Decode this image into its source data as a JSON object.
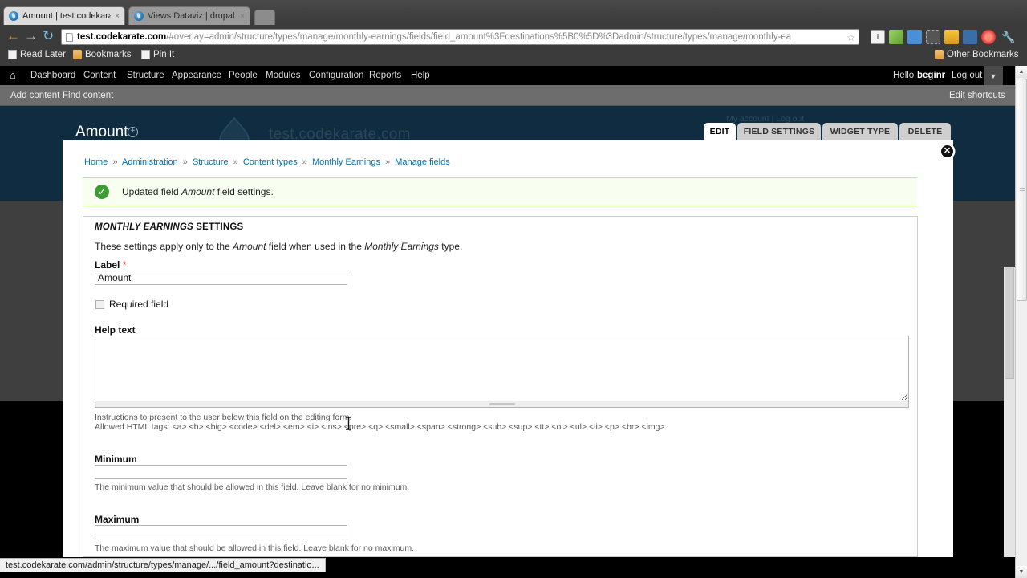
{
  "browser": {
    "tabs": [
      {
        "title": "Amount | test.codekarate",
        "active": true,
        "favicon": "drupal-favicon",
        "close": "×"
      },
      {
        "title": "Views Dataviz | drupal.org",
        "active": false,
        "favicon": "drupal-favicon",
        "close": "×"
      }
    ],
    "nav": {
      "back": "←",
      "forward": "→",
      "reload": "↻"
    },
    "url": {
      "host": "test.codekarate.com",
      "path": "/#overlay=admin/structure/types/manage/monthly-earnings/fields/field_amount%3Fdestinations%5B0%5D%3Dadmin/structure/types/manage/monthly-ea",
      "star_icon": "☆"
    },
    "toolbar_icons": [
      "info-icon",
      "eyedropper-icon",
      "screenshot-icon",
      "evernote-icon",
      "wallet-icon",
      "bookmark-manager-icon",
      "adblock-icon",
      "wrench-icon"
    ],
    "bookmarks": [
      {
        "label": "Read Later",
        "icon": "page-icon"
      },
      {
        "label": "Bookmarks",
        "icon": "folder-icon"
      },
      {
        "label": "Pin It",
        "icon": "page-icon"
      }
    ],
    "other_bookmarks": {
      "label": "Other Bookmarks",
      "icon": "folder-icon"
    },
    "status_bar": "test.codekarate.com/admin/structure/types/manage/.../field_amount?destinatio..."
  },
  "drupal_toolbar": {
    "home_icon": "⌂",
    "items": [
      "Dashboard",
      "Content",
      "Structure",
      "Appearance",
      "People",
      "Modules",
      "Configuration",
      "Reports",
      "Help"
    ],
    "greeting_prefix": "Hello",
    "username": "beginr",
    "logout": "Log out",
    "toggle_icon": "▼"
  },
  "shortcuts_bar": {
    "items": [
      "Add content",
      "Find content"
    ],
    "edit_link": "Edit shortcuts"
  },
  "page_header": {
    "watermark": "test.codekarate.com",
    "overlay_title": "Amount",
    "overlay_title_icon": "add-circle-icon",
    "account_links": "My account  |  Log out"
  },
  "field_tabs": [
    {
      "label": "EDIT",
      "active": true
    },
    {
      "label": "FIELD SETTINGS",
      "active": false
    },
    {
      "label": "WIDGET TYPE",
      "active": false
    },
    {
      "label": "DELETE",
      "active": false
    }
  ],
  "overlay": {
    "close_icon": "✕",
    "breadcrumb": [
      "Home",
      "Administration",
      "Structure",
      "Content types",
      "Monthly Earnings",
      "Manage fields"
    ],
    "breadcrumb_separator": "»",
    "status": {
      "icon": "check-circle-icon",
      "text_before": "Updated field ",
      "text_emphasis": "Amount",
      "text_after": " field settings."
    },
    "fieldset": {
      "legend_emphasis": "MONTHLY EARNINGS",
      "legend_rest": " SETTINGS",
      "description_a": "These settings apply only to the ",
      "description_em1": "Amount",
      "description_b": " field when used in the ",
      "description_em2": "Monthly Earnings",
      "description_c": " type."
    },
    "fields": {
      "label": {
        "label": "Label",
        "required_mark": "*",
        "value": "Amount"
      },
      "required_field": {
        "label": "Required field",
        "checked": false
      },
      "help_text": {
        "label": "Help text",
        "value": "",
        "description_line1": "Instructions to present to the user below this field on the editing form.",
        "description_line2": "Allowed HTML tags: <a> <b> <big> <code> <del> <em> <i> <ins> <pre> <q> <small> <span> <strong> <sub> <sup> <tt> <ol> <ul> <li> <p> <br> <img>"
      },
      "minimum": {
        "label": "Minimum",
        "value": "",
        "description": "The minimum value that should be allowed in this field. Leave blank for no minimum."
      },
      "maximum": {
        "label": "Maximum",
        "value": "",
        "description": "The maximum value that should be allowed in this field. Leave blank for no maximum."
      }
    }
  },
  "colors": {
    "drupal_header_navy": "#102c40",
    "toolbar_black": "#000000",
    "shortcut_gray": "#6d6d6d",
    "status_green": "#3f9b35",
    "link_blue": "#0071b3",
    "required_red": "#cc0000"
  }
}
